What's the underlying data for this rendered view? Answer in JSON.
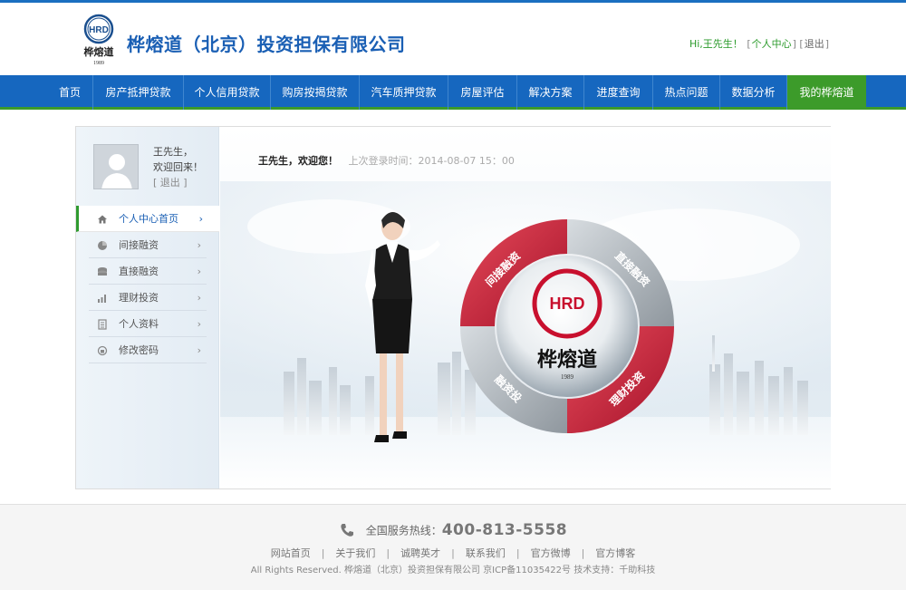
{
  "header": {
    "company_name": "桦熔道（北京）投资担保有限公司",
    "logo_text": "HRD",
    "logo_name": "桦熔道",
    "logo_year": "1989",
    "greeting": "Hi,王先生！",
    "user_center": "个人中心",
    "logout": "退出"
  },
  "nav": [
    {
      "label": "首页",
      "active": false
    },
    {
      "label": "房产抵押贷款",
      "active": false
    },
    {
      "label": "个人信用贷款",
      "active": false
    },
    {
      "label": "购房按揭贷款",
      "active": false
    },
    {
      "label": "汽车质押贷款",
      "active": false
    },
    {
      "label": "房屋评估",
      "active": false
    },
    {
      "label": "解决方案",
      "active": false
    },
    {
      "label": "进度查询",
      "active": false
    },
    {
      "label": "热点问题",
      "active": false
    },
    {
      "label": "数据分析",
      "active": false
    },
    {
      "label": "我的桦熔道",
      "active": true
    }
  ],
  "sidebar": {
    "user_name": "王先生，",
    "welcome_back": "欢迎回来！",
    "logout": "[ 退出 ]",
    "items": [
      {
        "label": "个人中心首页",
        "icon": "home-icon",
        "active": true
      },
      {
        "label": "间接融资",
        "icon": "pie-chart-icon",
        "active": false
      },
      {
        "label": "直接融资",
        "icon": "coins-stack-icon",
        "active": false
      },
      {
        "label": "理财投资",
        "icon": "bar-chart-icon",
        "active": false
      },
      {
        "label": "个人资料",
        "icon": "document-icon",
        "active": false
      },
      {
        "label": "修改密码",
        "icon": "lock-refresh-icon",
        "active": false
      }
    ]
  },
  "main": {
    "welcome": "王先生，欢迎您！",
    "last_login": "上次登录时间：2014-08-07  15：00",
    "ring_labels": [
      "间接融资",
      "直接融资",
      "理财投资",
      "融资投"
    ]
  },
  "footer": {
    "hotline_label": "全国服务热线：",
    "hotline_number": "400-813-5558",
    "links": [
      "网站首页",
      "关于我们",
      "诚聘英才",
      "联系我们",
      "官方微博",
      "官方博客"
    ],
    "copyright": "All Rights Reserved. 桦熔道（北京）投资担保有限公司    京ICP备11035422号  技术支持：千助科技"
  },
  "colors": {
    "brand_blue": "#1667bf",
    "accent_green": "#3c9b2a",
    "logo_red": "#c8102e"
  }
}
